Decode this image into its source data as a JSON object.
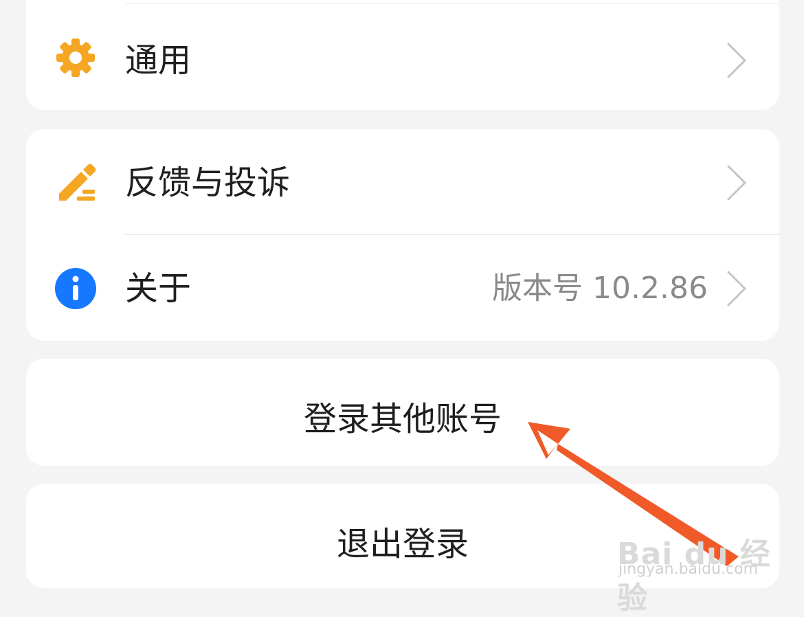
{
  "settings": {
    "general": {
      "label": "通用",
      "icon": "gear-icon",
      "icon_color": "#F5A623"
    },
    "feedback": {
      "label": "反馈与投诉",
      "icon": "edit-pen-icon",
      "icon_color": "#F5A623"
    },
    "about": {
      "label": "关于",
      "value": "版本号 10.2.86",
      "icon": "info-icon",
      "icon_color": "#1677FF"
    }
  },
  "actions": {
    "switch_account": "登录其他账号",
    "logout": "退出登录"
  },
  "annotation": {
    "arrow_color": "#F05A28"
  },
  "watermark": {
    "logo": "Bai du 经验",
    "url": "jingyan.baidu.com"
  }
}
